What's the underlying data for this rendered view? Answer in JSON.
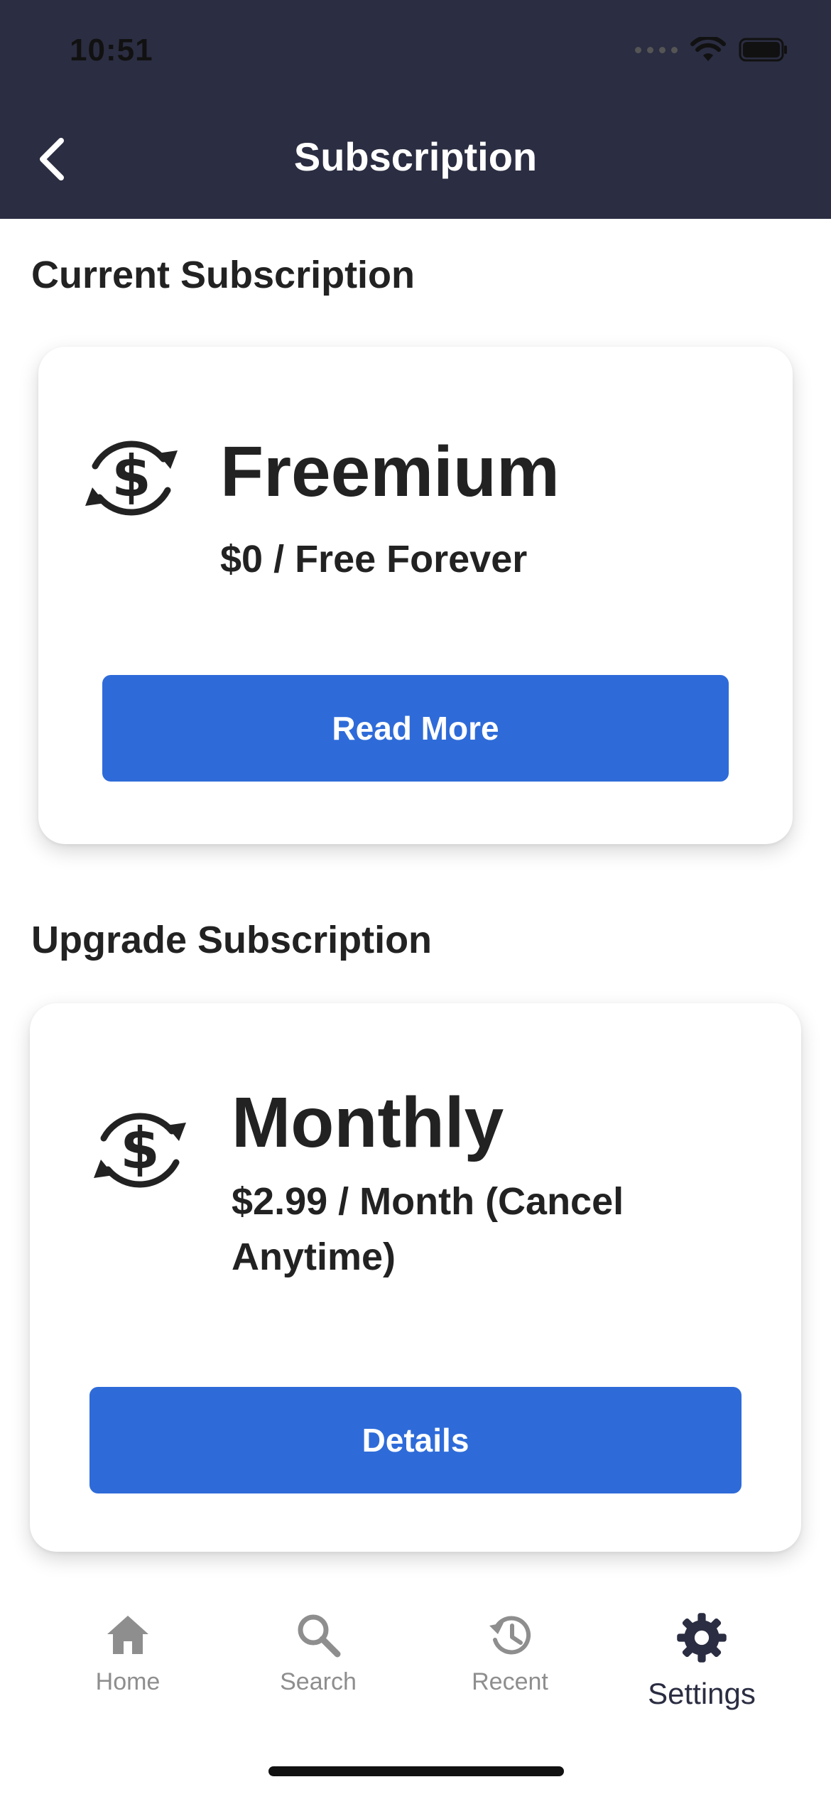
{
  "status_bar": {
    "time": "10:51"
  },
  "header": {
    "title": "Subscription"
  },
  "current_section": {
    "title": "Current Subscription",
    "plan_name": "Freemium",
    "plan_price": "$0 / Free Forever",
    "button_label": "Read More",
    "icon": "dollar-cycle-icon"
  },
  "upgrade_section": {
    "title": "Upgrade Subscription",
    "plan_name": "Monthly",
    "plan_price": "$2.99 / Month (Cancel Anytime)",
    "button_label": "Details",
    "icon": "dollar-cycle-icon"
  },
  "tabbar": {
    "items": [
      {
        "label": "Home",
        "icon": "home-icon"
      },
      {
        "label": "Search",
        "icon": "search-icon"
      },
      {
        "label": "Recent",
        "icon": "history-icon"
      },
      {
        "label": "Settings",
        "icon": "gear-icon",
        "active": true
      }
    ]
  },
  "colors": {
    "header_bg": "#2b2d42",
    "accent": "#2e6bd9",
    "tab_inactive": "#8e8e8e"
  }
}
